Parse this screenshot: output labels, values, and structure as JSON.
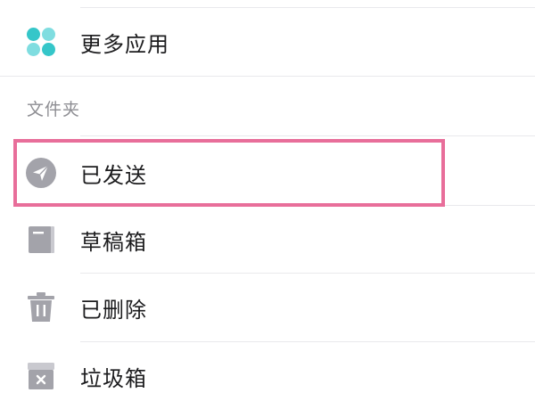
{
  "menu": {
    "more_apps": {
      "label": "更多应用",
      "icon": "apps-grid-icon"
    },
    "folders_header": "文件夹",
    "folders": [
      {
        "label": "已发送",
        "icon": "send-icon"
      },
      {
        "label": "草稿箱",
        "icon": "draft-icon"
      },
      {
        "label": "已删除",
        "icon": "trash-icon"
      },
      {
        "label": "垃圾箱",
        "icon": "spam-icon"
      }
    ]
  },
  "colors": {
    "highlight": "#e86e9a",
    "apps_icon": "#35c6c9",
    "folder_icon": "#a3a3aa",
    "text": "#1c1c1e",
    "header_text": "#8e8e93"
  }
}
